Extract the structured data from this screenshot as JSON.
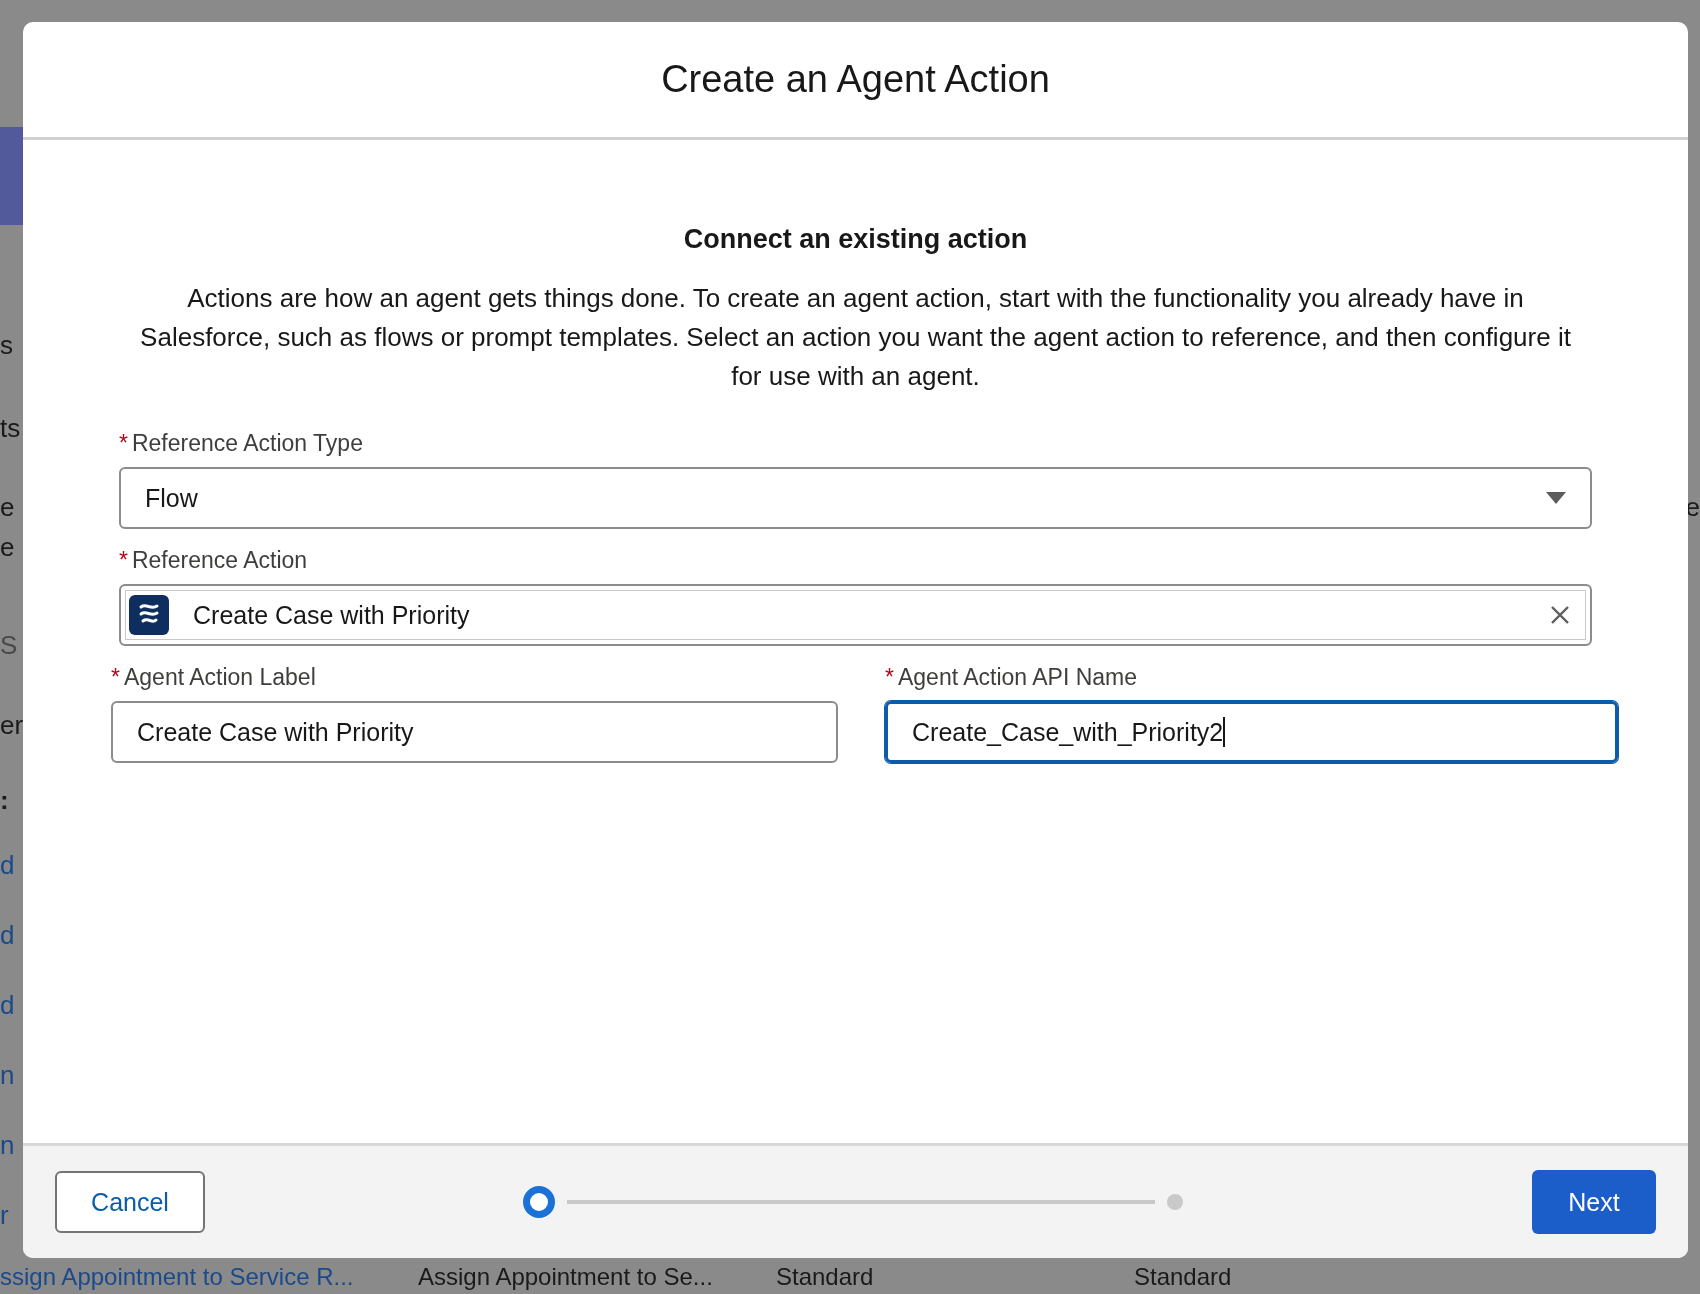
{
  "backdrop": {
    "left_fragments": [
      {
        "text": "s",
        "kind": "text"
      },
      {
        "text": "ts",
        "kind": "text"
      },
      {
        "text": "e",
        "kind": "text"
      },
      {
        "text": "e",
        "kind": "text"
      },
      {
        "text": "S",
        "kind": "placeholder"
      },
      {
        "text": "er",
        "kind": "text"
      },
      {
        "text": ":",
        "kind": "bold"
      },
      {
        "text": "d",
        "kind": "link"
      },
      {
        "text": "d",
        "kind": "link"
      },
      {
        "text": "d",
        "kind": "link"
      },
      {
        "text": "n",
        "kind": "link"
      },
      {
        "text": "n",
        "kind": "link"
      },
      {
        "text": "r",
        "kind": "link"
      }
    ],
    "right_fragments": [
      {
        "text": "e",
        "kind": "text"
      }
    ],
    "bottom_row": [
      {
        "text": "ssign Appointment to Service R...",
        "kind": "link"
      },
      {
        "text": "Assign Appointment to Se...",
        "kind": "text"
      },
      {
        "text": "Standard",
        "kind": "text"
      },
      {
        "text": "Standard",
        "kind": "text"
      }
    ]
  },
  "modal": {
    "title": "Create an Agent Action",
    "heading": "Connect an existing action",
    "description": "Actions are how an agent gets things done. To create an agent action, start with the functionality you already have in Salesforce, such as flows or prompt templates. Select an action you want the agent action to reference, and then configure it for use with an agent.",
    "fields": [
      {
        "kind": "select",
        "label": "Reference Action Type",
        "required_marker": "*",
        "value": "Flow",
        "focused": false
      },
      {
        "kind": "lookup",
        "label": "Reference Action",
        "required_marker": "*",
        "value": "Create Case with Priority",
        "focused": false
      }
    ],
    "split_fields": [
      {
        "kind": "text",
        "label": "Agent Action Label",
        "required_marker": "*",
        "value": "Create Case with Priority",
        "focused": false
      },
      {
        "kind": "text",
        "label": "Agent Action API Name",
        "required_marker": "*",
        "value": "Create_Case_with_Priority2",
        "focused": true
      }
    ]
  },
  "footer": {
    "cancel": "Cancel",
    "next": "Next",
    "steps": [
      {
        "selected": true
      },
      {
        "selected": false
      }
    ]
  }
}
